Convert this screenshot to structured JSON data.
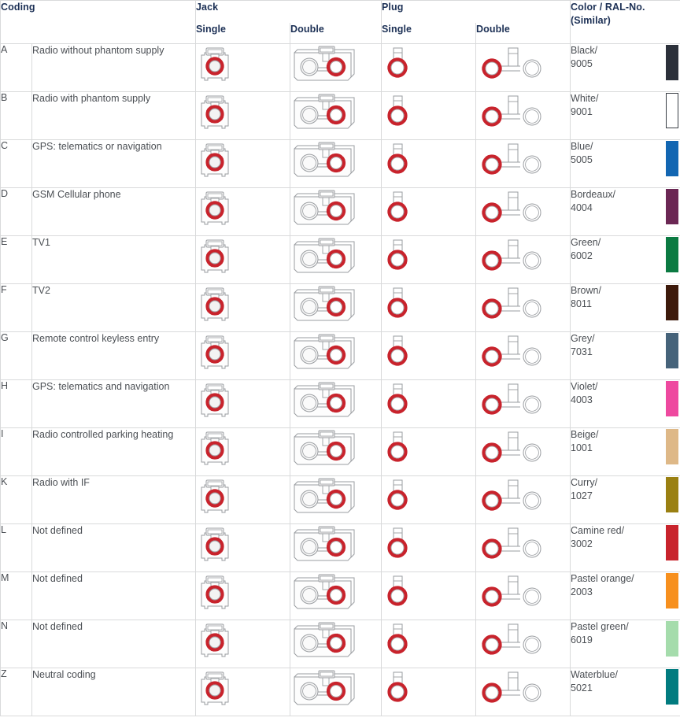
{
  "table": {
    "headers": {
      "coding": "Coding",
      "jack": "Jack",
      "plug": "Plug",
      "single_jack": "Single",
      "double_jack": "Double",
      "single_plug": "Single",
      "double_plug": "Double",
      "color_line1": "Color / RAL-No.",
      "color_line2": "(Similar)"
    },
    "icon_names": {
      "jack_single": "jack-single-connector-icon",
      "jack_double": "jack-double-connector-icon",
      "plug_single": "plug-single-connector-icon",
      "plug_double": "plug-double-connector-icon"
    },
    "palette": {
      "key_red": "#c8232c",
      "outline_grey": "#9a9da1",
      "body_fill": "#fdfdfd",
      "header_text": "#1c3055",
      "body_text": "#4b4f54",
      "grid_line": "#d9dadb"
    },
    "rows": [
      {
        "code": "A",
        "description": "Radio without phantom supply",
        "color_name": "Black/",
        "ral": "9005",
        "swatch_hex": "#2b303a",
        "outlined": false,
        "key_angle": 0
      },
      {
        "code": "B",
        "description": "Radio with phantom supply",
        "color_name": "White/",
        "ral": "9001",
        "swatch_hex": "#ffffff",
        "outlined": true,
        "key_angle": 30
      },
      {
        "code": "C",
        "description": "GPS: telematics or navigation",
        "color_name": "Blue/",
        "ral": "5005",
        "swatch_hex": "#1266b2",
        "outlined": false,
        "key_angle": 60
      },
      {
        "code": "D",
        "description": "GSM Cellular phone",
        "color_name": "Bordeaux/",
        "ral": "4004",
        "swatch_hex": "#6b2754",
        "outlined": false,
        "key_angle": 90
      },
      {
        "code": "E",
        "description": "TV1",
        "color_name": "Green/",
        "ral": "6002",
        "swatch_hex": "#0b7a42",
        "outlined": false,
        "key_angle": 120
      },
      {
        "code": "F",
        "description": "TV2",
        "color_name": "Brown/",
        "ral": "8011",
        "swatch_hex": "#3d1a0b",
        "outlined": false,
        "key_angle": 150
      },
      {
        "code": "G",
        "description": "Remote control keyless entry",
        "color_name": "Grey/",
        "ral": "7031",
        "swatch_hex": "#46637a",
        "outlined": false,
        "key_angle": 180
      },
      {
        "code": "H",
        "description": "GPS: telematics and navigation",
        "color_name": "Violet/",
        "ral": "4003",
        "swatch_hex": "#ee499f",
        "outlined": false,
        "key_angle": 210
      },
      {
        "code": "I",
        "description": "Radio controlled parking heating",
        "color_name": "Beige/",
        "ral": "1001",
        "swatch_hex": "#deb887",
        "outlined": false,
        "key_angle": 240
      },
      {
        "code": "K",
        "description": "Radio with IF",
        "color_name": "Curry/",
        "ral": "1027",
        "swatch_hex": "#9a8012",
        "outlined": false,
        "key_angle": 270
      },
      {
        "code": "L",
        "description": "Not defined",
        "color_name": "Camine red/",
        "ral": "3002",
        "swatch_hex": "#c8232c",
        "outlined": false,
        "key_angle": 300
      },
      {
        "code": "M",
        "description": "Not defined",
        "color_name": "Pastel orange/",
        "ral": "2003",
        "swatch_hex": "#f7901e",
        "outlined": false,
        "key_angle": 330
      },
      {
        "code": "N",
        "description": "Not defined",
        "color_name": "Pastel green/",
        "ral": "6019",
        "swatch_hex": "#a5dcac",
        "outlined": false,
        "key_angle": 15
      },
      {
        "code": "Z",
        "description": "Neutral coding",
        "color_name": "Waterblue/",
        "ral": "5021",
        "swatch_hex": "#017b7f",
        "outlined": false,
        "key_angle": 0,
        "neutral": true
      }
    ]
  }
}
